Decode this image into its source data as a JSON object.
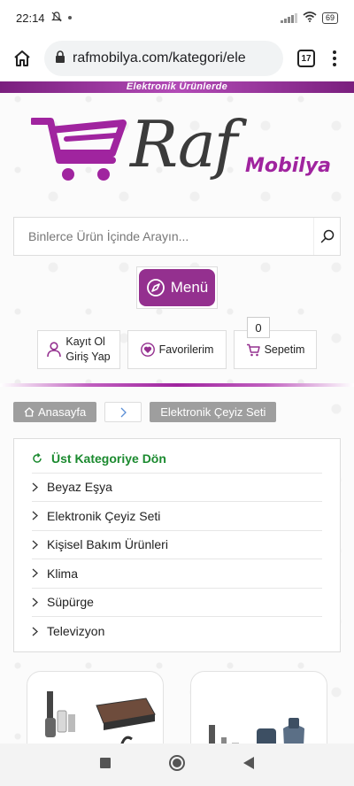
{
  "status": {
    "time": "22:14",
    "battery": "69"
  },
  "browser": {
    "url": "rafmobilya.com/kategori/ele",
    "tab_count": "17"
  },
  "promo": {
    "text": "Elektronik Ürünlerde"
  },
  "logo": {
    "raf": "Raf",
    "mobilya": "Mobilya"
  },
  "search": {
    "placeholder": "Binlerce Ürün İçinde Arayın..."
  },
  "menu": {
    "label": "Menü"
  },
  "actions": {
    "register": "Kayıt Ol",
    "login": "Giriş Yap",
    "favorites": "Favorilerim",
    "cart": "Sepetim",
    "cart_count": "0"
  },
  "breadcrumb": {
    "home": "Anasayfa",
    "current": "Elektronik Çeyiz Seti"
  },
  "categories": {
    "back": "Üst Kategoriye Dön",
    "items": [
      "Beyaz Eşya",
      "Elektronik Çeyiz Seti",
      "Kişisel Bakım Ürünleri",
      "Klima",
      "Süpürge",
      "Televizyon"
    ]
  },
  "colors": {
    "brand": "#94308f",
    "back_link": "#1b8a2f"
  }
}
